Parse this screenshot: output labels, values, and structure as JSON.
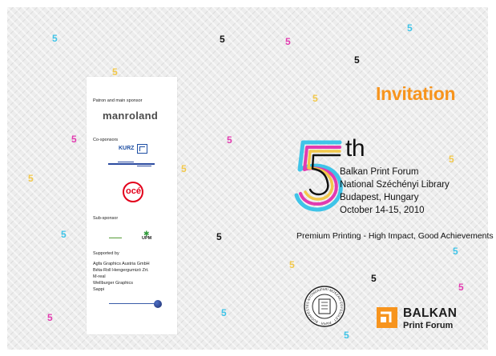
{
  "invitation": {
    "title": "Invitation",
    "number": "5",
    "ordinal_suffix": "th",
    "details": [
      "Balkan Print Forum",
      "National Széchényi Library",
      "Budapest, Hungary",
      "October 14-15, 2010"
    ],
    "tagline": "Premium Printing - High Impact, Good Achievements"
  },
  "sponsors": {
    "patron_heading": "Patron and main sponsor",
    "main_sponsor_logo": "manroland",
    "cosponsors_heading": "Co-sponsors",
    "cosponsor_logos": [
      "KURZ",
      "océ"
    ],
    "subsponsor_heading": "Sub-sponsor",
    "subsponsor_logo": "UPM",
    "supported_heading": "Supported by",
    "supporters": [
      "Agfa Graphics Austria GmbH",
      "Béta-Roll Hengergumizó Zrt.",
      "M-real",
      "Wellburger Graphics",
      "Sappi"
    ]
  },
  "organizer": {
    "name": "BALKAN",
    "subtitle": "Print Forum",
    "seal_text": "ÉS NYOMDAIPARI MŰSZAKI EGYESÜLET · PAPÍR · BUDAPEST · 1948"
  },
  "colors": {
    "accent_orange": "#f7941d",
    "cyan": "#3fc4e8",
    "magenta": "#e23bb0",
    "yellow": "#f2c84a",
    "black": "#111111"
  },
  "decorations": {
    "scattered_glyph": "5"
  }
}
